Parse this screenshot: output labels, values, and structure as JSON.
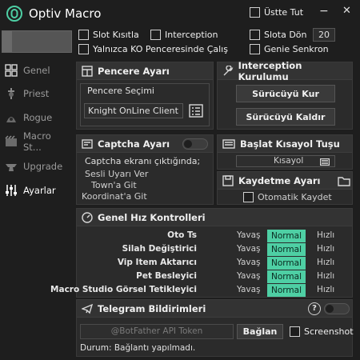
{
  "app": {
    "title": "Optiv Macro"
  },
  "window": {
    "always_on_top": "Üstte Tut",
    "minimize": "−",
    "close": "✕"
  },
  "options": {
    "slot_limit": "Slot Kısıtla",
    "interception": "Interception",
    "slot_turn": "Slota Dön",
    "slot_turn_value": "20",
    "only_ko_window": "Yalnızca KO Penceresinde Çalış",
    "genie_sync": "Genie Senkron"
  },
  "sidebar": {
    "items": [
      {
        "label": "Genel",
        "icon": "grid-icon"
      },
      {
        "label": "Priest",
        "icon": "priest-icon"
      },
      {
        "label": "Rogue",
        "icon": "rogue-icon"
      },
      {
        "label": "Macro St...",
        "icon": "film-icon"
      },
      {
        "label": "Upgrade",
        "icon": "anvil-icon"
      },
      {
        "label": "Ayarlar",
        "icon": "sliders-icon"
      }
    ]
  },
  "window_settings": {
    "title": "Pencere Ayarı",
    "select_label": "Pencere Seçimi",
    "selected_window": "Knight OnLine Client"
  },
  "interception_setup": {
    "title": "Interception Kurulumu",
    "install": "Sürücüyü Kur",
    "remove": "Sürücüyü Kaldır"
  },
  "captcha": {
    "title": "Captcha Ayarı",
    "when_shown": "Captcha ekranı çıktığında;",
    "sound_alert": "Sesli Uyarı Ver",
    "goto_town": "Town'a Git",
    "goto_coord": "Koordinat'a Git"
  },
  "start_hotkey": {
    "title": "Başlat Kısayol Tuşu",
    "field": "Kısayol"
  },
  "save_settings": {
    "title": "Kaydetme Ayarı",
    "auto_save": "Otomatik Kaydet"
  },
  "speed": {
    "title": "Genel Hız Kontrolleri",
    "slow": "Yavaş",
    "fast": "Hızlı",
    "rows": [
      {
        "name": "Oto Ts",
        "value": "Normal"
      },
      {
        "name": "Silah Değiştirici",
        "value": "Normal"
      },
      {
        "name": "Vip Item Aktarıcı",
        "value": "Normal"
      },
      {
        "name": "Pet Besleyici",
        "value": "Normal"
      },
      {
        "name": "Macro Studio Görsel Tetikleyici",
        "value": "Normal"
      }
    ]
  },
  "telegram": {
    "title": "Telegram Bildirimleri",
    "help": "?",
    "token_placeholder": "@BotFather API Token",
    "connect": "Bağlan",
    "screenshot": "Screenshot",
    "status": "Durum: Bağlantı yapılmadı."
  },
  "colors": {
    "accent": "#4ecfa4",
    "background": "#1e1e1e",
    "panel": "#2b2b2b"
  }
}
